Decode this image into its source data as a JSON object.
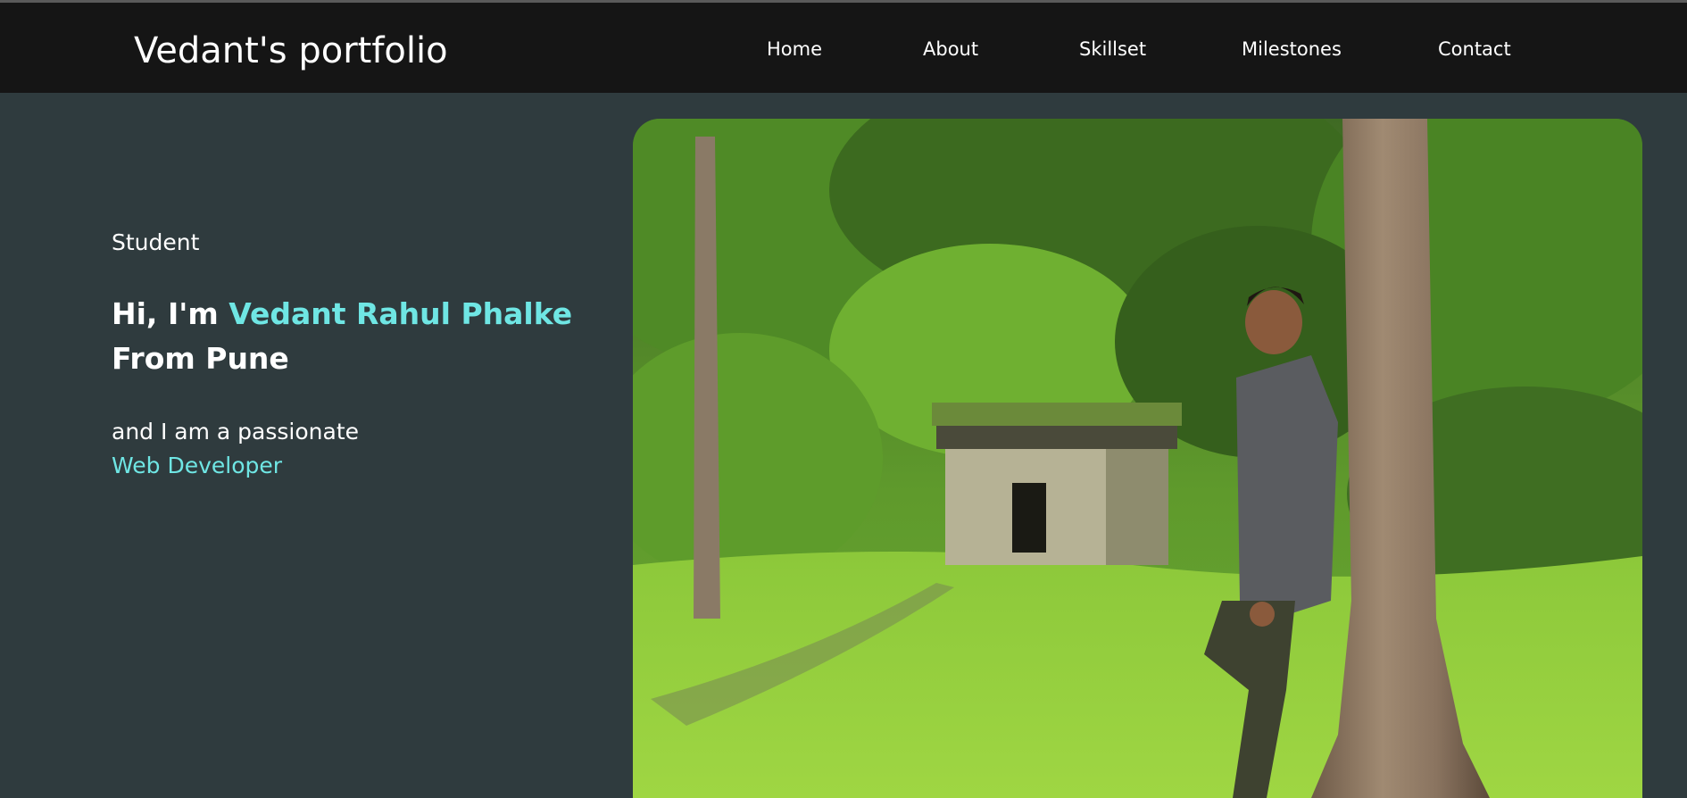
{
  "header": {
    "brand": "Vedant's portfolio",
    "nav": [
      {
        "label": "Home"
      },
      {
        "label": "About"
      },
      {
        "label": "Skillset"
      },
      {
        "label": "Milestones"
      },
      {
        "label": "Contact"
      }
    ]
  },
  "hero": {
    "role": "Student",
    "greeting_prefix": "Hi, I'm ",
    "name": "Vedant Rahul Phalke",
    "origin": "From Pune",
    "tagline_prefix": "and I am a passionate",
    "profession": "Web Developer"
  },
  "colors": {
    "background": "#2f3b3e",
    "navbar": "#151515",
    "accent": "#6fe6e4",
    "text": "#ffffff"
  }
}
